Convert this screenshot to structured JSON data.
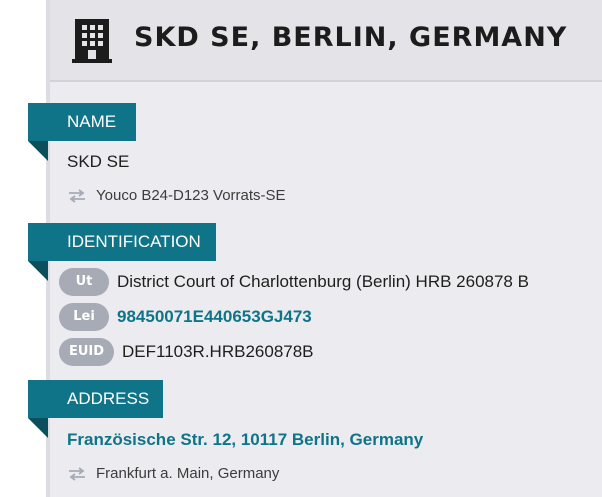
{
  "header": {
    "title": "SKD SE, BERLIN, GERMANY",
    "icon": "building-icon"
  },
  "name_section": {
    "label": "NAME",
    "current": "SKD SE",
    "previous": "Youco B24-D123 Vorrats-SE",
    "previous_icon": "swap-arrows-icon"
  },
  "identification": {
    "label": "IDENTIFICATION",
    "items": [
      {
        "badge": "Ut",
        "value": "District Court of Charlottenburg (Berlin) HRB 260878 B"
      },
      {
        "badge": "Lei",
        "value": "98450071E440653GJ473"
      },
      {
        "badge": "EUID",
        "value": "DEF1103R.HRB260878B"
      }
    ]
  },
  "address": {
    "label": "ADDRESS",
    "current": "Französische Str. 12, 10117 Berlin, Germany",
    "previous": "Frankfurt a. Main, Germany",
    "previous_icon": "swap-arrows-icon"
  },
  "colors": {
    "accent": "#0f7487",
    "accent_dark": "#0b4f5c",
    "badge": "#a6abb6",
    "panel": "#ececf0"
  }
}
